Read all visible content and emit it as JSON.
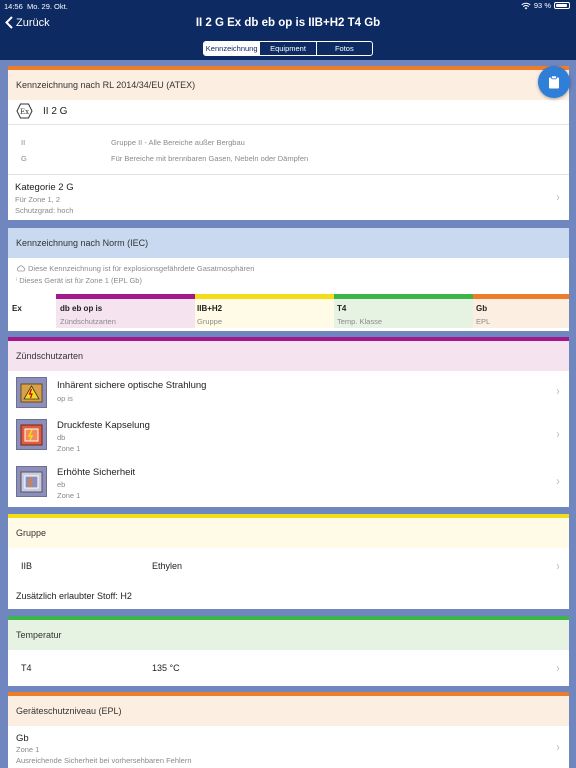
{
  "status_bar": {
    "time": "14:56",
    "date": "Mo. 29. Okt.",
    "battery": "93 %",
    "battery_level": 0.93
  },
  "nav": {
    "back_label": "Zurück",
    "title": "II 2 G Ex db eb op is IIB+H2 T4 Gb",
    "tabs": [
      {
        "label": "Kennzeichnung"
      },
      {
        "label": "Equipment"
      },
      {
        "label": "Fotos"
      }
    ]
  },
  "atex": {
    "header": "Kennzeichnung nach RL 2014/34/EU (ATEX)",
    "marking": "II 2 G",
    "rows": [
      {
        "code": "II",
        "desc": "Gruppe II - Alle Bereiche außer Bergbau"
      },
      {
        "code": "G",
        "desc": "Für Bereiche mit brennbaren Gasen, Nebeln oder Dämpfen"
      }
    ],
    "category": {
      "title": "Kategorie 2 G",
      "line1": "Für Zone 1, 2",
      "line2": "Schutzgrad: hoch"
    }
  },
  "iec": {
    "header": "Kennzeichnung nach Norm (IEC)",
    "note1": "Diese Kennzeichnung ist für explosionsgefährdete Gasatmosphären",
    "note2": "Dieses Gerät ist für Zone 1 (EPL Gb)",
    "ex_label": "Ex",
    "columns": [
      {
        "value": "db eb op is",
        "label": "Zündschutzarten",
        "bar_color": "#a21a8a",
        "bg": "#f5e4f0"
      },
      {
        "value": "IIB+H2",
        "label": "Gruppe",
        "bar_color": "#f2dd1a",
        "bg": "#fffbe6"
      },
      {
        "value": "T4",
        "label": "Temp. Klasse",
        "bar_color": "#3db54a",
        "bg": "#e6f3e2"
      },
      {
        "value": "Gb",
        "label": "EPL",
        "bar_color": "#ee7d2b",
        "bg": "#fcefe2"
      }
    ]
  },
  "protection": {
    "header": "Zündschutzarten",
    "items": [
      {
        "title": "Inhärent sichere optische Strahlung",
        "sub1": "op is",
        "sub2": ""
      },
      {
        "title": "Druckfeste Kapselung",
        "sub1": "db",
        "sub2": "Zone 1"
      },
      {
        "title": "Erhöhte Sicherheit",
        "sub1": "eb",
        "sub2": "Zone 1"
      }
    ]
  },
  "group": {
    "header": "Gruppe",
    "code": "IIB",
    "value": "Ethylen",
    "extra": "Zusätzlich erlaubter Stoff: H2"
  },
  "temperature": {
    "header": "Temperatur",
    "code": "T4",
    "value": "135 °C"
  },
  "epl": {
    "header": "Geräteschutzniveau (EPL)",
    "code": "Gb",
    "line1": "Zone 1",
    "line2": "Ausreichende Sicherheit bei vorhersehbaren Fehlern"
  },
  "colors": {
    "navy": "#0d2a63",
    "page_bg": "#6f86bf",
    "atex": "#ee7d2b",
    "iec": "#2f5fa8",
    "protection": "#a21a8a",
    "group": "#f2dd1a",
    "temperature": "#3db54a",
    "epl": "#ee7d2b"
  }
}
